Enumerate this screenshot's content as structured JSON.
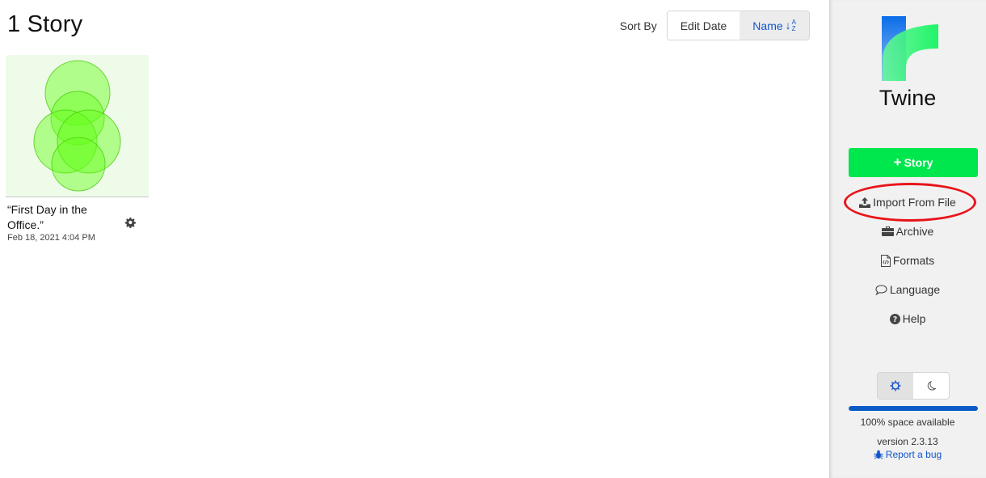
{
  "header": {
    "title": "1 Story",
    "sort_label": "Sort By",
    "sort_options": [
      {
        "label": "Edit Date",
        "active": false
      },
      {
        "label": "Name",
        "active": true,
        "icon": "sort-alpha-down-icon"
      }
    ]
  },
  "stories": [
    {
      "name": "“First Day in the Office.”",
      "date": "Feb 18, 2021 4:04 PM",
      "preview_color": "#66ff1a"
    }
  ],
  "sidebar": {
    "brand": "Twine",
    "new_story_label": "Story",
    "nav": [
      {
        "label": "Import From File",
        "icon": "upload-icon",
        "highlighted": true
      },
      {
        "label": "Archive",
        "icon": "briefcase-icon"
      },
      {
        "label": "Formats",
        "icon": "code-file-icon"
      },
      {
        "label": "Language",
        "icon": "speech-bubble-icon"
      },
      {
        "label": "Help",
        "icon": "question-circle-icon"
      }
    ],
    "theme": {
      "options": [
        "light",
        "dark"
      ],
      "selected": "light"
    },
    "storage": {
      "percent_available": 100,
      "text": "100% space available"
    },
    "version": "version 2.3.13",
    "report_bug": "Report a bug"
  },
  "colors": {
    "accent_green": "#00e64d",
    "link_blue": "#1155cc",
    "highlight_red": "#e8141a",
    "storage_blue": "#0b5ac6"
  }
}
